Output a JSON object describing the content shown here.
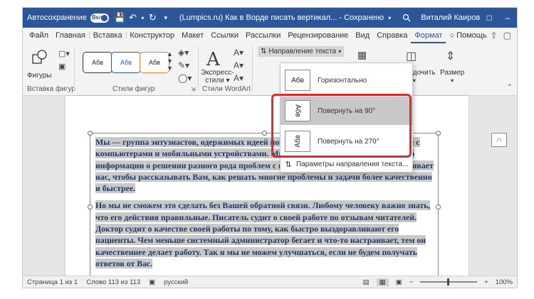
{
  "titlebar": {
    "autosave_label": "Автосохранение",
    "autosave_state": "Вкл.",
    "doc_title": "(Lumpics.ru) Как в Ворде писать вертикал...  -  Сохранено",
    "user": "Виталий Каиров",
    "accent": "#2b579a"
  },
  "menu": {
    "tabs": [
      "Файл",
      "Главная",
      "Вставка",
      "Конструктор",
      "Макет",
      "Ссылки",
      "Рассылки",
      "Рецензирование",
      "Вид",
      "Справка",
      "Формат"
    ],
    "active_tab": "Формат",
    "help": "Помощь"
  },
  "ribbon": {
    "shapes_label": "Фигуры",
    "insert_shapes_group": "Вставка фигур",
    "styles_group": "Стили фигур",
    "style_previews": [
      "Абв",
      "Абв",
      "Абв"
    ],
    "express_styles": "Экспресс-\nстили",
    "wordart_group": "Стили WordArt",
    "text_direction": "Направление текста",
    "arrange": "Упорядочить",
    "size": "Размер"
  },
  "dropdown": {
    "items": [
      {
        "preview": "Абв",
        "label": "Горизонтально"
      },
      {
        "preview": "Абв",
        "label": "Повернуть на 90°"
      },
      {
        "preview": "Абв",
        "label": "Повернуть на 270°"
      }
    ],
    "options_label": "Параметры направления текста...",
    "highlight_color": "#d32f2f"
  },
  "document": {
    "p1": "Мы — группа энтузиастов, одержимых идеей помогать Вам в ежедневном контакте с компьютерами и мобильными устройствами. Мы знаем, что в интернете уже полно информации о решении разного рода проблем с компьютерами. Но это не останавливает нас, чтобы рассказывать Вам, как решать многие проблемы и задачи более качественно и быстрее.",
    "p2": "Но мы не сможем это сделать без Вашей обратной связи. Любому человеку важно знать, что его действия правильные. Писатель судит о своей работе по отзывам читателей. Доктор судит о качестве своей работы по тому, как быстро выздоравливают его пациенты. Чем меньше системный администратор бегает и что-то настраивает, тем он качественнее делает работу. Так и мы не можем улучшаться, если не будем получать ответов от Вас."
  },
  "status": {
    "page": "Страница 1 из 1",
    "words": "Слово 113 из 113",
    "lang": "русский",
    "zoom": "100%"
  }
}
